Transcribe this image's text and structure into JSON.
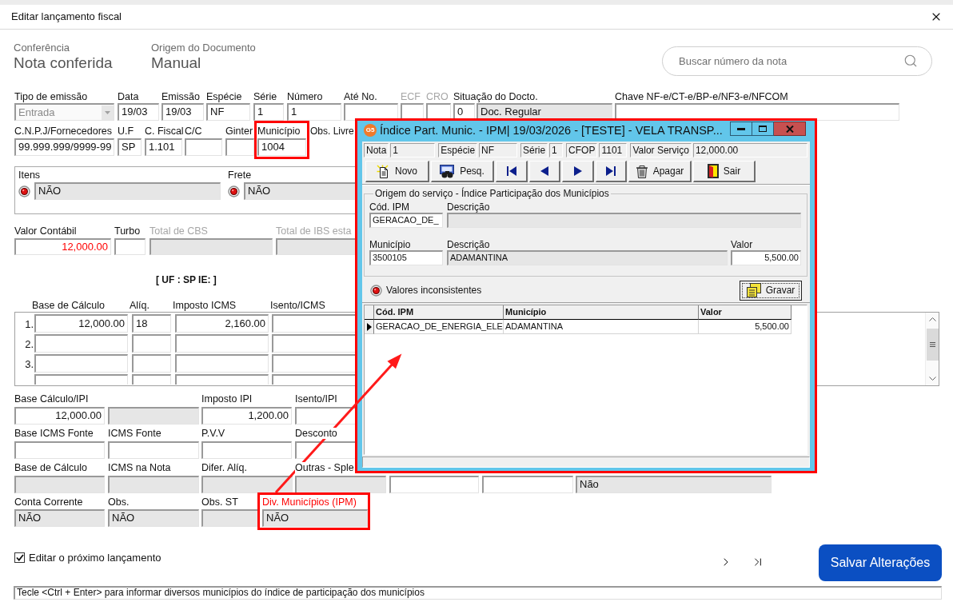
{
  "window": {
    "title": "Editar lançamento fiscal"
  },
  "header": {
    "info": [
      {
        "label": "Conferência",
        "value": "Nota conferida"
      },
      {
        "label": "Origem do Documento",
        "value": "Manual"
      }
    ],
    "search": {
      "placeholder": "Buscar número da nota"
    }
  },
  "document_fields": [
    {
      "kind": "combo",
      "label": "Tipo de emissão",
      "value": "Entrada",
      "disabled": true,
      "readonly": false
    },
    {
      "kind": "text",
      "label": "Data",
      "value": "19/03",
      "disabled": false,
      "readonly": false
    },
    {
      "kind": "text",
      "label": "Emissão",
      "value": "19/03",
      "disabled": false,
      "readonly": false
    },
    {
      "kind": "text",
      "label": "Espécie",
      "value": "NF",
      "disabled": false,
      "readonly": false
    },
    {
      "kind": "text",
      "label": "Série",
      "value": "1",
      "disabled": false,
      "readonly": false
    },
    {
      "kind": "text",
      "label": "Número",
      "value": "1",
      "disabled": false,
      "readonly": false
    },
    {
      "kind": "text",
      "label": "Até No.",
      "disabled": false,
      "readonly": false
    },
    {
      "kind": "text",
      "label": "ECF",
      "disabled": true,
      "readonly": false
    },
    {
      "kind": "text",
      "label": "CRO",
      "disabled": true,
      "readonly": false
    },
    {
      "kind": "pair",
      "label": "Situação do Docto.",
      "code": "0",
      "value": "Doc. Regular",
      "disabled": false,
      "readonly": true
    },
    {
      "kind": "text",
      "label": "Chave NF-e/CT-e/BP-e/NF3-e/NFCOM",
      "disabled": false,
      "readonly": false
    }
  ],
  "supplier_fields": [
    {
      "kind": "text",
      "label": "C.N.P.J/Fornecedores",
      "value": "99.999.999/9999-99",
      "highlighted": false
    },
    {
      "kind": "text",
      "label": "U.F",
      "value": "SP",
      "highlighted": false
    },
    {
      "kind": "text",
      "label": "C. Fiscal",
      "value": "1.101",
      "highlighted": false
    },
    {
      "kind": "text",
      "label": "C/C",
      "highlighted": false
    },
    {
      "kind": "text",
      "label": "Ginter",
      "highlighted": false
    },
    {
      "kind": "text",
      "label": "Município",
      "value": "1004",
      "highlighted": true
    },
    {
      "kind": "caption",
      "label": "Obs. Livre",
      "highlighted": false
    }
  ],
  "flags": [
    {
      "label": "Itens",
      "value": "NÃO",
      "readonly": true
    },
    {
      "label": "Frete",
      "value": "NÃO",
      "readonly": true
    }
  ],
  "totals": [
    {
      "label": "Valor Contábil",
      "value": "12,000.00",
      "disabled": false,
      "readonly": false,
      "value_alert": true
    },
    {
      "label": "Turbo",
      "disabled": false,
      "readonly": false
    },
    {
      "label": "Total de CBS",
      "disabled": true,
      "readonly": true
    },
    {
      "label": "Total de IBS esta",
      "disabled": true,
      "readonly": true
    }
  ],
  "uf_caption": "[ UF : SP IE: ]",
  "icms_grid": {
    "columns": [
      "Base de Cálculo",
      "Alíq.",
      "Imposto ICMS",
      "Isento/ICMS"
    ],
    "rows": [
      {
        "number": "1.",
        "cells": [
          "12,000.00",
          "18",
          "2,160.00"
        ]
      },
      {
        "number": "2."
      },
      {
        "number": "3."
      },
      {}
    ]
  },
  "ipi_fields": [
    {
      "label": "Base Cálculo/IPI",
      "value": "12,000.00",
      "readonly": false
    },
    {
      "readonly": true
    },
    {
      "label": "Imposto IPI",
      "value": "1,200.00",
      "readonly": false
    },
    {
      "label": "Isento/IPI",
      "readonly": false
    }
  ],
  "fonte_fields": [
    {
      "label": "Base ICMS Fonte",
      "readonly": false
    },
    {
      "label": "ICMS Fonte",
      "readonly": false
    },
    {
      "label": "P.V.V",
      "readonly": false
    },
    {
      "label": "Desconto",
      "readonly": false
    }
  ],
  "nota_fields": [
    {
      "label": "Base de Cálculo",
      "readonly": true
    },
    {
      "label": "ICMS na Nota",
      "readonly": true
    },
    {
      "label": "Difer. Alíq.",
      "readonly": true
    },
    {
      "label": "Outras - Sple",
      "readonly": true
    },
    {
      "readonly": false
    },
    {
      "readonly": false
    },
    {
      "value": "Não",
      "readonly": true
    }
  ],
  "account_fields": [
    {
      "label": "Conta Corrente",
      "value": "NÃO",
      "readonly": true,
      "label_alert": false,
      "highlighted": false
    },
    {
      "label": "Obs.",
      "value": "NÃO",
      "readonly": true,
      "label_alert": false,
      "highlighted": false
    },
    {
      "label": "Obs. ST",
      "readonly": true,
      "label_alert": false,
      "highlighted": false
    },
    {
      "label": "Div. Municípios (IPM)",
      "value": "NÃO",
      "readonly": true,
      "label_alert": true,
      "highlighted": true
    }
  ],
  "edit_next": {
    "label": "Editar o próximo lançamento",
    "checked": true
  },
  "save_button": {
    "label": "Salvar Alterações"
  },
  "status_bar": {
    "text": "Tecle <Ctrl + Enter> para informar diversos municípios do índice de participação dos municípios"
  },
  "ipm_dialog": {
    "logo": "G5",
    "title": "Índice Part. Munic. - IPM| 19/03/2026 - [TESTE] - VELA TRANSP...",
    "highlighted": true,
    "summary": [
      {
        "label": "Nota",
        "value": "1"
      },
      {
        "label": "Espécie",
        "value": "NF"
      },
      {
        "label": "Série",
        "value": "1"
      },
      {
        "label": "CFOP",
        "value": "1101"
      },
      {
        "label": "Valor Serviço",
        "value": "12,000.00"
      }
    ],
    "toolbar": [
      {
        "kind": "new",
        "label": "Novo"
      },
      {
        "kind": "search",
        "label": "Pesq."
      },
      {
        "kind": "first"
      },
      {
        "kind": "previous"
      },
      {
        "kind": "next"
      },
      {
        "kind": "last"
      },
      {
        "kind": "delete",
        "label": "Apagar"
      },
      {
        "kind": "exit",
        "label": "Sair"
      }
    ],
    "group": {
      "title": "Origem do serviço - Índice Participação dos Municípios",
      "rows": [
        [
          {
            "label": "Cód. IPM",
            "value": "GERACAO_DE_",
            "readonly": false
          },
          {
            "label": "Descrição",
            "readonly": true
          }
        ],
        [
          {
            "label": "Município",
            "value": "3500105",
            "readonly": false
          },
          {
            "label": "Descrição",
            "value": "ADAMANTINA",
            "readonly": true
          },
          {
            "label": "Valor",
            "value": "5,500.00",
            "readonly": false
          }
        ]
      ]
    },
    "status": {
      "label": "Valores inconsistentes"
    },
    "save_button": {
      "label": "Gravar"
    },
    "grid": {
      "columns": [
        "Cód. IPM",
        "Município",
        "Valor"
      ],
      "rows": [
        {
          "cells": [
            "GERACAO_DE_ENERGIA_ELE",
            "ADAMANTINA",
            "5,500.00"
          ],
          "selected": true
        }
      ]
    }
  }
}
